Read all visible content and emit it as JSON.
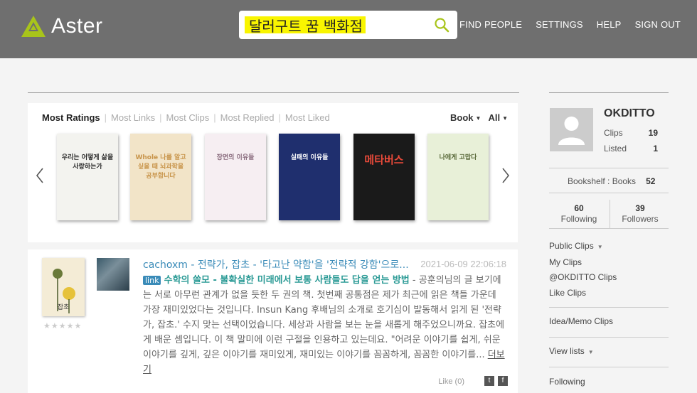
{
  "header": {
    "logo_text": "Aster",
    "search_value": "달러구트 꿈 백화점",
    "nav": [
      "FIND PEOPLE",
      "SETTINGS",
      "HELP",
      "SIGN OUT"
    ]
  },
  "books_panel": {
    "tabs": [
      "Most Ratings",
      "Most Links",
      "Most Clips",
      "Most Replied",
      "Most Liked"
    ],
    "active_tab": "Most Ratings",
    "filter_type": "Book",
    "filter_scope": "All",
    "covers": [
      {
        "title": "우리는 어떻게 삶을 사랑하는가",
        "bg": "#f3f3ef",
        "fg": "#2b2b2b"
      },
      {
        "title": "Whole 나를 알고 싶을 때 뇌과학을 공부합니다",
        "bg": "#f2e4c8",
        "fg": "#c8944a"
      },
      {
        "title": "장면의 이유들",
        "bg": "#f6eef2",
        "fg": "#8a6c7e"
      },
      {
        "title": "실패의 이유들",
        "bg": "#1f2f6e",
        "fg": "#ffffff"
      },
      {
        "title": "메타버스",
        "bg": "#1a1a1a",
        "fg": "#e94a3a"
      },
      {
        "title": "나에게 고맙다",
        "bg": "#e8f0d8",
        "fg": "#5a6a3a"
      }
    ]
  },
  "feed": {
    "book_title": "잡초",
    "head": "cachoxm - 전략가, 잡초 - '타고난 약함'을 '전략적 강함'으로...",
    "date": "2021-06-09 22:06:18",
    "link_tag": "link",
    "clip_title": "수학의 쓸모 - 불확실한 미래에서 보통 사람들도 답을 얻는 방법",
    "body": " - 공훈의님의 글 보기에는 서로 아무런 관계가 없을 듯한 두 권의 책. 첫번째 공통점은 제가 최근에 읽은 책들 가운데 가장 재미있었다는 것입니다. Insun Kang 후배님의 소개로 호기심이 발동해서 읽게 된 '전략가, 잡초.' 수지 맞는 선택이었습니다. 세상과 사람을 보는 눈을 새롭게 해주었으니까요. 잡초에게 배운 셈입니다. 이 책 말미에 이런 구절을 인용하고 있는데요. \"어려운 이야기를 쉽게, 쉬운 이야기를 깊게, 깊은 이야기를 재미있게, 재미있는 이야기를 꼼꼼하게, 꼼꼼한 이야기를... ",
    "more": "더보기",
    "like": "Like (0)",
    "stars": "★★★★★"
  },
  "sidebar": {
    "name": "OKDITTO",
    "clips_label": "Clips",
    "clips_value": "19",
    "listed_label": "Listed",
    "listed_value": "1",
    "bookshelf_label": "Bookshelf : Books",
    "bookshelf_value": "52",
    "following_value": "60",
    "following_label": "Following",
    "followers_value": "39",
    "followers_label": "Followers",
    "menu1": [
      "Public Clips",
      "My Clips",
      "@OKDITTO Clips",
      "Like Clips"
    ],
    "menu2": "Idea/Memo Clips",
    "menu3": "View lists",
    "menu4": "Following"
  },
  "colors": {
    "header_bg": "#6f6f6f",
    "accent_green": "#a8c41a",
    "link_blue": "#3a8bb8",
    "title_teal": "#2a9a95",
    "search_highlight": "#f9f500"
  }
}
